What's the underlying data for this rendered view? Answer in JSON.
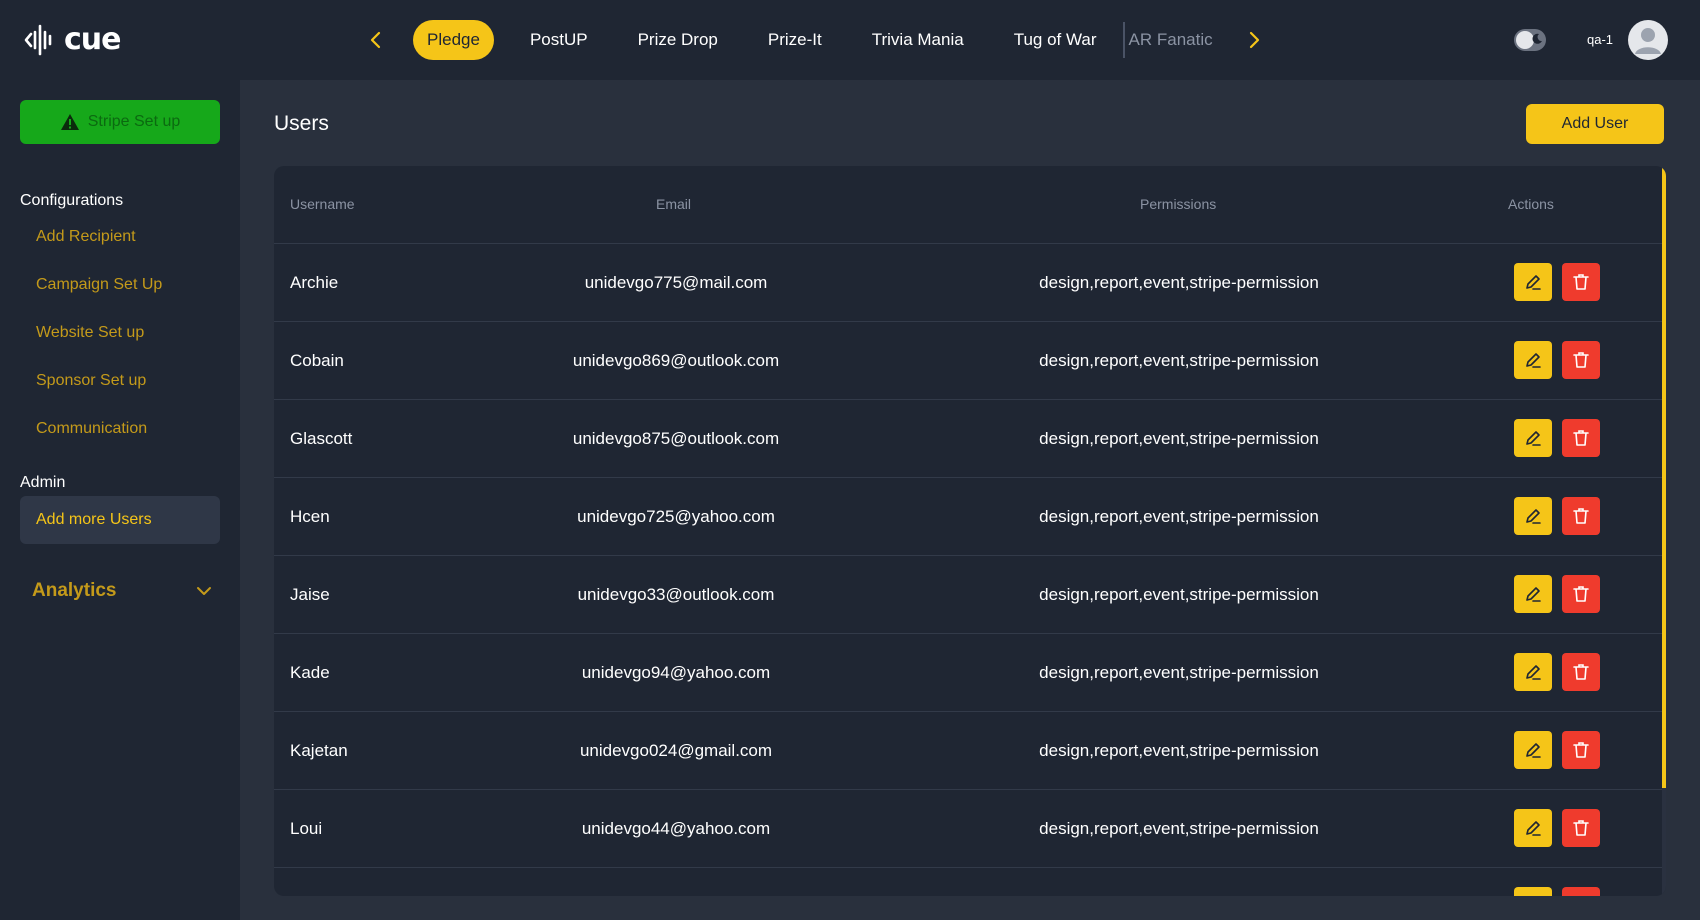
{
  "app": {
    "logo_text": "cue"
  },
  "topnav": {
    "tabs": [
      {
        "label": "Pledge",
        "active": true
      },
      {
        "label": "PostUP",
        "active": false
      },
      {
        "label": "Prize Drop",
        "active": false
      },
      {
        "label": "Prize-It",
        "active": false
      },
      {
        "label": "Trivia Mania",
        "active": false
      },
      {
        "label": "Tug of War",
        "active": false
      },
      {
        "label": "AR Fanatic",
        "active": false
      }
    ],
    "user_label": "qa-1"
  },
  "sidebar": {
    "stripe_button": "Stripe Set up",
    "configurations_heading": "Configurations",
    "config_items": [
      {
        "label": "Add Recipient"
      },
      {
        "label": "Campaign Set Up"
      },
      {
        "label": "Website Set up"
      },
      {
        "label": "Sponsor Set up"
      },
      {
        "label": "Communication"
      }
    ],
    "admin_heading": "Admin",
    "admin_active_item": "Add more Users",
    "analytics_label": "Analytics"
  },
  "main": {
    "title": "Users",
    "add_user_button": "Add User",
    "table": {
      "headers": {
        "username": "Username",
        "email": "Email",
        "permissions": "Permissions",
        "actions": "Actions"
      },
      "rows": [
        {
          "username": "Archie",
          "email": "unidevgo775@mail.com",
          "permissions": "design,report,event,stripe-permission"
        },
        {
          "username": "Cobain",
          "email": "unidevgo869@outlook.com",
          "permissions": "design,report,event,stripe-permission"
        },
        {
          "username": "Glascott",
          "email": "unidevgo875@outlook.com",
          "permissions": "design,report,event,stripe-permission"
        },
        {
          "username": "Hcen",
          "email": "unidevgo725@yahoo.com",
          "permissions": "design,report,event,stripe-permission"
        },
        {
          "username": "Jaise",
          "email": "unidevgo33@outlook.com",
          "permissions": "design,report,event,stripe-permission"
        },
        {
          "username": "Kade",
          "email": "unidevgo94@yahoo.com",
          "permissions": "design,report,event,stripe-permission"
        },
        {
          "username": "Kajetan",
          "email": "unidevgo024@gmail.com",
          "permissions": "design,report,event,stripe-permission"
        },
        {
          "username": "Loui",
          "email": "unidevgo44@yahoo.com",
          "permissions": "design,report,event,stripe-permission"
        }
      ]
    }
  },
  "icons": {
    "logo": "waveform-logo-icon",
    "nav_prev": "chevron-left-icon",
    "nav_next": "chevron-right-icon",
    "theme_toggle": "moon-icon",
    "avatar": "user-avatar-icon",
    "warning": "warning-triangle-icon",
    "analytics_expand": "chevron-down-icon",
    "edit": "pencil-icon",
    "delete": "trash-icon"
  },
  "colors": {
    "accent": "#f5c518",
    "background": "#1f2633",
    "panel": "#29303d",
    "stripe_button": "#16a81a",
    "delete": "#ef3b2d",
    "sidebar_link": "#c49a1a"
  }
}
